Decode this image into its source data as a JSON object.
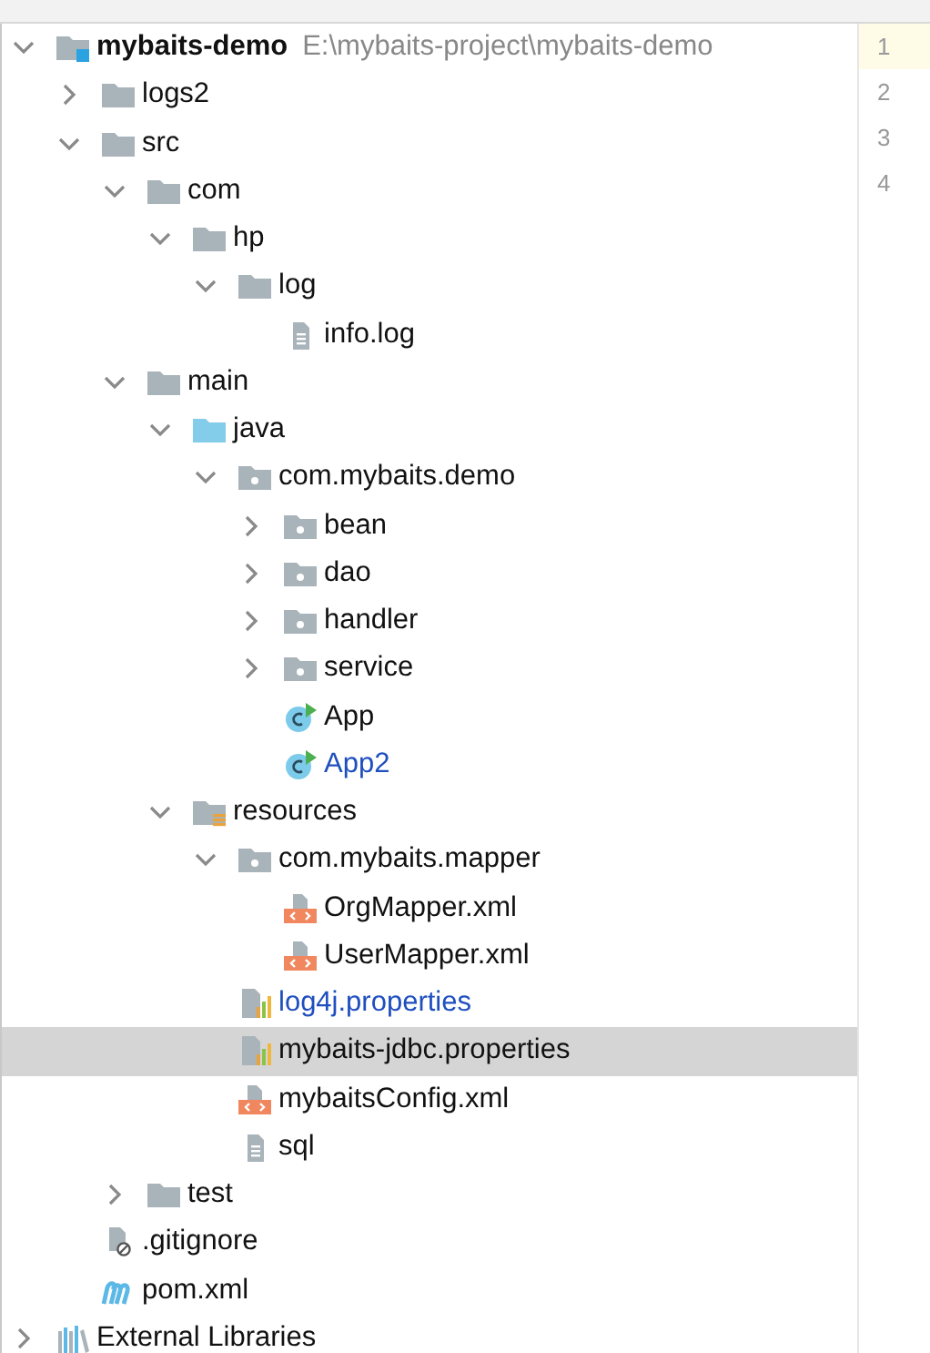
{
  "tree": [
    {
      "name": "mybaits-demo",
      "path": "E:\\mybaits-project\\mybaits-demo",
      "kind": "module",
      "expanded": true,
      "selected": false,
      "modified": false,
      "children": [
        {
          "name": "logs2",
          "kind": "folder",
          "expanded": false,
          "selected": false,
          "modified": false
        },
        {
          "name": "src",
          "kind": "folder",
          "expanded": true,
          "selected": false,
          "modified": false,
          "children": [
            {
              "name": "com",
              "kind": "folder",
              "expanded": true,
              "selected": false,
              "modified": false,
              "children": [
                {
                  "name": "hp",
                  "kind": "folder",
                  "expanded": true,
                  "selected": false,
                  "modified": false,
                  "children": [
                    {
                      "name": "log",
                      "kind": "folder",
                      "expanded": true,
                      "selected": false,
                      "modified": false,
                      "children": [
                        {
                          "name": "info.log",
                          "kind": "text",
                          "selected": false,
                          "modified": false
                        }
                      ]
                    }
                  ]
                }
              ]
            },
            {
              "name": "main",
              "kind": "folder",
              "expanded": true,
              "selected": false,
              "modified": false,
              "children": [
                {
                  "name": "java",
                  "kind": "source",
                  "expanded": true,
                  "selected": false,
                  "modified": false,
                  "children": [
                    {
                      "name": "com.mybaits.demo",
                      "kind": "package",
                      "expanded": true,
                      "selected": false,
                      "modified": false,
                      "children": [
                        {
                          "name": "bean",
                          "kind": "package",
                          "expanded": false,
                          "selected": false,
                          "modified": false
                        },
                        {
                          "name": "dao",
                          "kind": "package",
                          "expanded": false,
                          "selected": false,
                          "modified": false
                        },
                        {
                          "name": "handler",
                          "kind": "package",
                          "expanded": false,
                          "selected": false,
                          "modified": false
                        },
                        {
                          "name": "service",
                          "kind": "package",
                          "expanded": false,
                          "selected": false,
                          "modified": false
                        },
                        {
                          "name": "App",
                          "kind": "class",
                          "selected": false,
                          "modified": false
                        },
                        {
                          "name": "App2",
                          "kind": "class",
                          "selected": false,
                          "modified": true
                        }
                      ]
                    }
                  ]
                },
                {
                  "name": "resources",
                  "kind": "resources",
                  "expanded": true,
                  "selected": false,
                  "modified": false,
                  "children": [
                    {
                      "name": "com.mybaits.mapper",
                      "kind": "package",
                      "expanded": true,
                      "selected": false,
                      "modified": false,
                      "children": [
                        {
                          "name": "OrgMapper.xml",
                          "kind": "xml",
                          "selected": false,
                          "modified": false
                        },
                        {
                          "name": "UserMapper.xml",
                          "kind": "xml",
                          "selected": false,
                          "modified": false
                        }
                      ]
                    },
                    {
                      "name": "log4j.properties",
                      "kind": "properties",
                      "selected": false,
                      "modified": true
                    },
                    {
                      "name": "mybaits-jdbc.properties",
                      "kind": "properties",
                      "selected": true,
                      "modified": false
                    },
                    {
                      "name": "mybaitsConfig.xml",
                      "kind": "xml",
                      "selected": false,
                      "modified": false
                    },
                    {
                      "name": "sql",
                      "kind": "text",
                      "selected": false,
                      "modified": false
                    }
                  ]
                }
              ]
            },
            {
              "name": "test",
              "kind": "folder",
              "expanded": false,
              "selected": false,
              "modified": false
            }
          ]
        },
        {
          "name": ".gitignore",
          "kind": "gitignore",
          "selected": false,
          "modified": false
        },
        {
          "name": "pom.xml",
          "kind": "maven",
          "selected": false,
          "modified": false
        }
      ]
    },
    {
      "name": "External Libraries",
      "kind": "libraries",
      "expanded": false,
      "selected": false,
      "modified": false
    }
  ],
  "gutter": [
    {
      "number": "1",
      "current": true
    },
    {
      "number": "2",
      "current": false
    },
    {
      "number": "3",
      "current": false
    },
    {
      "number": "4",
      "current": false
    }
  ]
}
